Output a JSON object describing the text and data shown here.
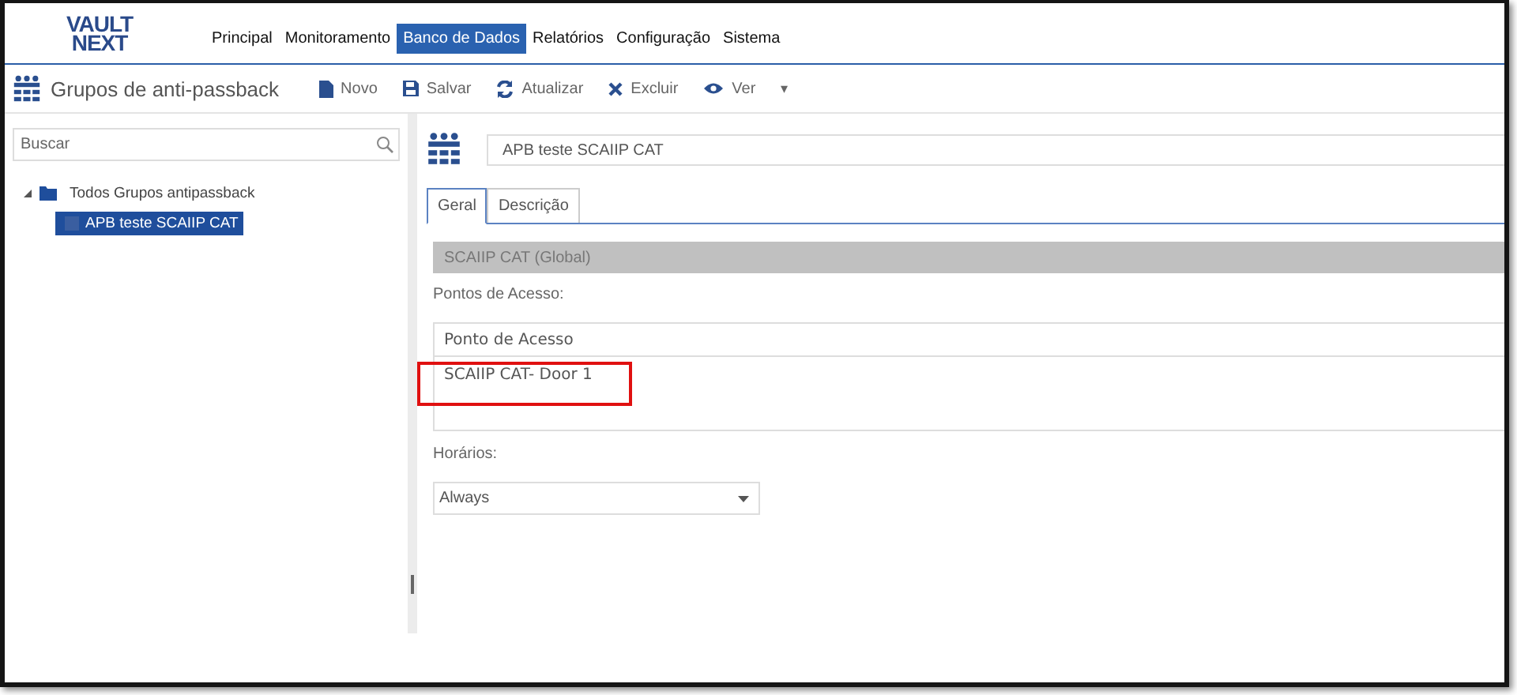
{
  "logo": [
    "VAULT",
    "NEXT"
  ],
  "nav": [
    {
      "label": "Principal",
      "selected": false
    },
    {
      "label": "Monitoramento",
      "selected": false
    },
    {
      "label": "Banco de Dados",
      "selected": true
    },
    {
      "label": "Relatórios",
      "selected": false
    },
    {
      "label": "Configuração",
      "selected": false
    },
    {
      "label": "Sistema",
      "selected": false
    }
  ],
  "page_title": "Grupos de anti-passback",
  "toolbar": [
    {
      "kind": "new",
      "label": "Novo"
    },
    {
      "kind": "save",
      "label": "Salvar"
    },
    {
      "kind": "refresh",
      "label": "Atualizar"
    },
    {
      "kind": "delete",
      "label": "Excluir"
    },
    {
      "kind": "view",
      "label": "Ver"
    },
    {
      "kind": "menu",
      "label": "▾"
    }
  ],
  "search": {
    "placeholder": "Buscar"
  },
  "tree": [
    {
      "label": "Todos Grupos antipassback",
      "expanded": true,
      "selected": false,
      "children": [
        {
          "label": "APB teste SCAIIP CAT",
          "selected": true
        }
      ]
    }
  ],
  "detail": {
    "name": "APB teste SCAIIP CAT",
    "tabs": [
      {
        "label": "Geral",
        "selected": true
      },
      {
        "label": "Descrição",
        "selected": false
      }
    ],
    "section_bar": "SCAIIP CAT (Global)",
    "access_label": "Pontos de Acesso:",
    "access_table": {
      "columns": [
        "Ponto de Acesso"
      ],
      "rows": [
        "SCAIIP CAT- Door 1"
      ]
    },
    "schedule_label": "Horários:",
    "schedule": {
      "value": "Always"
    }
  }
}
